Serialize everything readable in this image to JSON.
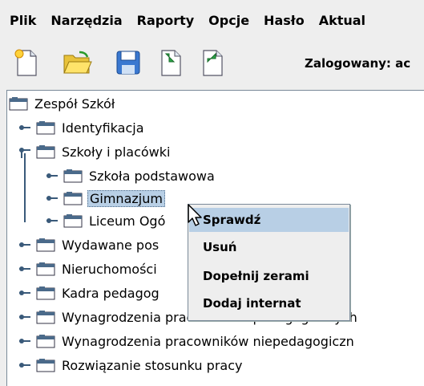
{
  "menubar": {
    "items": [
      {
        "label": "Plik"
      },
      {
        "label": "Narzędzia"
      },
      {
        "label": "Raporty"
      },
      {
        "label": "Opcje"
      },
      {
        "label": "Hasło"
      },
      {
        "label": "Aktual"
      }
    ]
  },
  "toolbar": {
    "buttons": [
      {
        "icon": "new-document-icon"
      },
      {
        "icon": "open-folder-icon"
      },
      {
        "icon": "save-disk-icon"
      },
      {
        "icon": "import-document-icon"
      },
      {
        "icon": "export-document-icon"
      }
    ],
    "login_label": "Zalogowany: ac"
  },
  "tree": {
    "root": "Zespół Szkół",
    "nodes": [
      {
        "label": "Identyfikacja"
      },
      {
        "label": "Szkoły i placówki"
      },
      {
        "label": "Szkoła podstawowa"
      },
      {
        "label": "Gimnazjum"
      },
      {
        "label": "Liceum Ogó"
      },
      {
        "label": "Wydawane pos"
      },
      {
        "label": "Nieruchomości"
      },
      {
        "label": "Kadra pedagog"
      },
      {
        "label": "Wynagrodzenia pracowników pedagogicznych"
      },
      {
        "label": "Wynagrodzenia pracowników niepedagogiczn"
      },
      {
        "label": "Rozwiązanie stosunku pracy"
      }
    ]
  },
  "context_menu": {
    "items": [
      {
        "label": "Sprawdź"
      },
      {
        "label": "Usuń"
      },
      {
        "label": "Dopełnij zerami"
      },
      {
        "label": "Dodaj internat"
      }
    ],
    "highlighted_index": 0
  },
  "colors": {
    "selection": "#b8cfe5",
    "background": "#eeeeee",
    "tree_bg": "#ffffff"
  }
}
